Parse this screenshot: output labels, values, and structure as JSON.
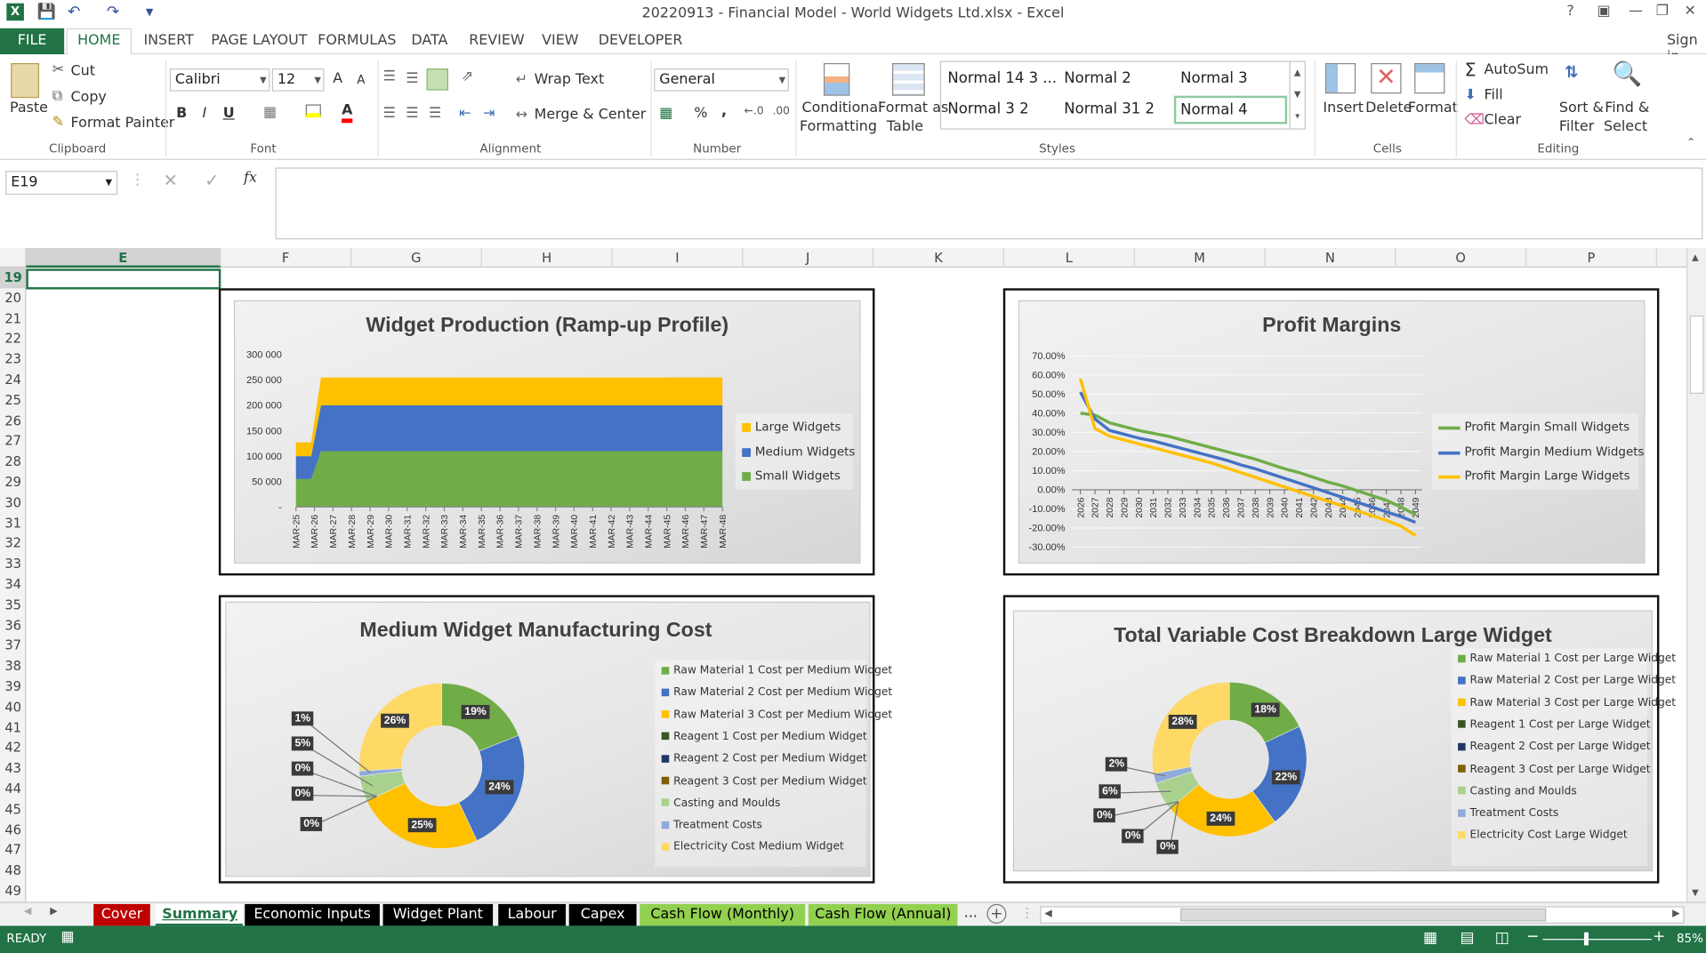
{
  "app": {
    "title": "20220913 - Financial Model - World Widgets Ltd.xlsx - Excel",
    "help": "?",
    "sign_in": "Sign in"
  },
  "ribbon_tabs": [
    "FILE",
    "HOME",
    "INSERT",
    "PAGE LAYOUT",
    "FORMULAS",
    "DATA",
    "REVIEW",
    "VIEW",
    "DEVELOPER"
  ],
  "clipboard": {
    "paste": "Paste",
    "cut": "Cut",
    "copy": "Copy",
    "format_painter": "Format Painter",
    "group": "Clipboard"
  },
  "font": {
    "name": "Calibri",
    "size": "12",
    "group": "Font",
    "bold": "B",
    "italic": "I",
    "underline": "U",
    "grow": "A",
    "shrink": "A",
    "color_letter": "A"
  },
  "alignment": {
    "wrap": "Wrap Text",
    "merge": "Merge & Center",
    "group": "Alignment"
  },
  "number": {
    "format": "General",
    "group": "Number",
    "percent": "%",
    "comma": ","
  },
  "styles": {
    "conditional_1": "Conditional",
    "conditional_2": "Formatting",
    "table_1": "Format as",
    "table_2": "Table",
    "group": "Styles",
    "items": [
      "Normal 14 3 ...",
      "Normal 2",
      "Normal 3",
      "Normal 3 2",
      "Normal 31 2",
      "Normal 4"
    ]
  },
  "cells": {
    "insert": "Insert",
    "delete": "Delete",
    "format": "Format",
    "group": "Cells"
  },
  "editing": {
    "autosum": "AutoSum",
    "fill": "Fill",
    "clear": "Clear",
    "sort_1": "Sort &",
    "sort_2": "Filter",
    "find_1": "Find &",
    "find_2": "Select",
    "group": "Editing"
  },
  "formula_bar": {
    "name_box": "E19",
    "fx": "fx",
    "content": ""
  },
  "columns": [
    "E",
    "F",
    "G",
    "H",
    "I",
    "J",
    "K",
    "L",
    "M",
    "N",
    "O",
    "P"
  ],
  "rows": [
    "19",
    "20",
    "21",
    "22",
    "23",
    "24",
    "25",
    "26",
    "27",
    "28",
    "29",
    "30",
    "31",
    "32",
    "33",
    "34",
    "35",
    "36",
    "37",
    "38",
    "39",
    "40",
    "41",
    "42",
    "43",
    "44",
    "45",
    "46",
    "47",
    "48",
    "49"
  ],
  "sheet_tabs": [
    {
      "label": "Cover",
      "bg": "#c00000",
      "fg": "#ffffff"
    },
    {
      "label": "Summary",
      "bg": "#ffffff",
      "fg": "#217346"
    },
    {
      "label": "Economic Inputs",
      "bg": "#000000",
      "fg": "#ffffff"
    },
    {
      "label": "Widget Plant",
      "bg": "#000000",
      "fg": "#ffffff"
    },
    {
      "label": "Labour",
      "bg": "#000000",
      "fg": "#ffffff"
    },
    {
      "label": "Capex",
      "bg": "#000000",
      "fg": "#ffffff"
    },
    {
      "label": "Cash Flow (Monthly)",
      "bg": "#92d050",
      "fg": "#000000"
    },
    {
      "label": "Cash Flow (Annual)",
      "bg": "#92d050",
      "fg": "#000000"
    }
  ],
  "more_sheets": "...",
  "status": {
    "ready": "READY",
    "zoom": "85%"
  },
  "colors": {
    "excel_green": "#217346",
    "small": "#70ad47",
    "medium": "#4472c4",
    "large": "#ffc000"
  },
  "chart_data": [
    {
      "type": "area",
      "title": "Widget Production (Ramp-up Profile)",
      "x": [
        "MAR-25",
        "MAR-26",
        "MAR-27",
        "MAR-28",
        "MAR-29",
        "MAR-30",
        "MAR-31",
        "MAR-32",
        "MAR-33",
        "MAR-34",
        "MAR-35",
        "MAR-36",
        "MAR-37",
        "MAR-38",
        "MAR-39",
        "MAR-40",
        "MAR-41",
        "MAR-42",
        "MAR-43",
        "MAR-44",
        "MAR-45",
        "MAR-46",
        "MAR-47",
        "MAR-48"
      ],
      "stacked": true,
      "series": [
        {
          "name": "Small Widgets",
          "values": [
            55000,
            55000,
            110000,
            110000,
            110000,
            110000,
            110000,
            110000,
            110000,
            110000,
            110000,
            110000,
            110000,
            110000,
            110000,
            110000,
            110000,
            110000,
            110000,
            110000,
            110000,
            110000,
            110000,
            110000
          ]
        },
        {
          "name": "Medium Widgets",
          "values": [
            45000,
            45000,
            90000,
            90000,
            90000,
            90000,
            90000,
            90000,
            90000,
            90000,
            90000,
            90000,
            90000,
            90000,
            90000,
            90000,
            90000,
            90000,
            90000,
            90000,
            90000,
            90000,
            90000,
            90000
          ]
        },
        {
          "name": "Large Widgets",
          "values": [
            27500,
            27500,
            55000,
            55000,
            55000,
            55000,
            55000,
            55000,
            55000,
            55000,
            55000,
            55000,
            55000,
            55000,
            55000,
            55000,
            55000,
            55000,
            55000,
            55000,
            55000,
            55000,
            55000,
            55000
          ]
        }
      ],
      "yticks": [
        "300 000",
        "250 000",
        "200 000",
        "150 000",
        "100 000",
        "50 000",
        "-"
      ],
      "ylim": [
        0,
        300000
      ],
      "legend": "right"
    },
    {
      "type": "line",
      "title": "Profit Margins",
      "x": [
        "2026",
        "2027",
        "2028",
        "2029",
        "2030",
        "2031",
        "2032",
        "2033",
        "2034",
        "2035",
        "2036",
        "2037",
        "2038",
        "2039",
        "2040",
        "2041",
        "2042",
        "2043",
        "2044",
        "2045",
        "2046",
        "2047",
        "2048",
        "2049"
      ],
      "series": [
        {
          "name": "Profit Margin Small Widgets",
          "values": [
            40,
            39,
            35,
            33,
            31,
            29.5,
            28,
            26,
            24,
            22,
            20,
            18,
            16,
            13.5,
            11,
            9,
            6.5,
            4,
            2,
            -0.5,
            -3,
            -5.5,
            -9,
            -13
          ]
        },
        {
          "name": "Profit Margin Medium Widgets",
          "values": [
            51,
            37,
            31,
            29,
            27,
            25.5,
            23.5,
            21.5,
            19.5,
            17.5,
            15.5,
            13,
            11,
            8.5,
            6,
            3.5,
            1,
            -1.5,
            -4,
            -6.5,
            -9,
            -11.5,
            -14,
            -17
          ]
        },
        {
          "name": "Profit Margin Large Widgets",
          "values": [
            58,
            32,
            28,
            26,
            24,
            22,
            20,
            18,
            16,
            14,
            11.5,
            9,
            6.5,
            4,
            1.5,
            -1,
            -3.5,
            -6,
            -8.5,
            -11,
            -13.5,
            -16,
            -19,
            -24
          ]
        }
      ],
      "yticks": [
        "70.00%",
        "60.00%",
        "50.00%",
        "40.00%",
        "30.00%",
        "20.00%",
        "10.00%",
        "0.00%",
        "-10.00%",
        "-20.00%",
        "-30.00%"
      ],
      "ylim": [
        -30,
        70
      ],
      "legend": "right"
    },
    {
      "type": "pie",
      "title": "Medium Widget Manufacturing Cost",
      "slices": [
        {
          "name": "Raw Material 1 Cost per Medium Widget",
          "value": 19,
          "label": "19%",
          "color": "#70ad47"
        },
        {
          "name": "Raw Material 2 Cost per Medium Widget",
          "value": 24,
          "label": "24%",
          "color": "#4472c4"
        },
        {
          "name": "Raw Material 3 Cost per Medium Widget",
          "value": 25,
          "label": "25%",
          "color": "#ffc000"
        },
        {
          "name": "Reagent 1 Cost per Medium Widget",
          "value": 0,
          "label": "0%",
          "color": "#375623"
        },
        {
          "name": "Reagent 2 Cost per Medium Widget",
          "value": 0,
          "label": "0%",
          "color": "#203864"
        },
        {
          "name": "Reagent 3 Cost per Medium Widget",
          "value": 0,
          "label": "0%",
          "color": "#7f6000"
        },
        {
          "name": "Casting and Moulds",
          "value": 5,
          "label": "5%",
          "color": "#a9d18e"
        },
        {
          "name": "Treatment Costs",
          "value": 1,
          "label": "1%",
          "color": "#8faadc"
        },
        {
          "name": "Electricity Cost Medium Widget",
          "value": 26,
          "label": "26%",
          "color": "#ffd966"
        }
      ],
      "legend": "right"
    },
    {
      "type": "pie",
      "title": "Total Variable Cost Breakdown Large Widget",
      "slices": [
        {
          "name": "Raw Material 1 Cost per Large Widget",
          "value": 18,
          "label": "18%",
          "color": "#70ad47"
        },
        {
          "name": "Raw Material 2 Cost per Large Widget",
          "value": 22,
          "label": "22%",
          "color": "#4472c4"
        },
        {
          "name": "Raw Material 3 Cost per Large Widget",
          "value": 24,
          "label": "24%",
          "color": "#ffc000"
        },
        {
          "name": "Reagent 1 Cost per Large Widget",
          "value": 0,
          "label": "0%",
          "color": "#375623"
        },
        {
          "name": "Reagent 2 Cost per Large Widget",
          "value": 0,
          "label": "0%",
          "color": "#203864"
        },
        {
          "name": "Reagent 3 Cost per Large Widget",
          "value": 0,
          "label": "0%",
          "color": "#7f6000"
        },
        {
          "name": "Casting and Moulds",
          "value": 6,
          "label": "6%",
          "color": "#a9d18e"
        },
        {
          "name": "Treatment Costs",
          "value": 2,
          "label": "2%",
          "color": "#8faadc"
        },
        {
          "name": "Electricity Cost Large Widget",
          "value": 28,
          "label": "28%",
          "color": "#ffd966"
        }
      ],
      "legend": "right"
    }
  ]
}
